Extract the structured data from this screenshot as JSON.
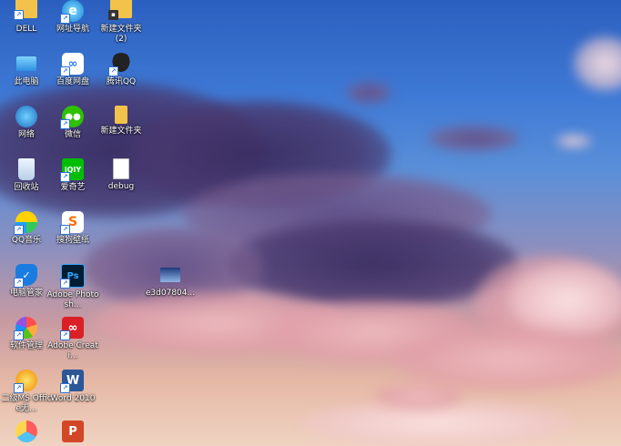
{
  "desktop": {
    "icons": [
      {
        "label": "DELL",
        "icon": "folder-icon"
      },
      {
        "label": "网址导航",
        "icon": "ie-browser-icon"
      },
      {
        "label": "新建文件夹\n(2)",
        "icon": "folder-icon"
      },
      {
        "label": "此电脑",
        "icon": "computer-icon"
      },
      {
        "label": "百度网盘",
        "icon": "baidu-netdisk-icon"
      },
      {
        "label": "腾讯QQ",
        "icon": "qq-penguin-icon"
      },
      {
        "label": "网络",
        "icon": "network-icon"
      },
      {
        "label": "微信",
        "icon": "wechat-icon"
      },
      {
        "label": "新建文件夹",
        "icon": "folder-icon"
      },
      {
        "label": "回收站",
        "icon": "recycle-bin-icon"
      },
      {
        "label": "爱奇艺",
        "icon": "iqiyi-icon"
      },
      {
        "label": "debug",
        "icon": "document-icon"
      },
      {
        "label": "QQ音乐",
        "icon": "qq-music-icon"
      },
      {
        "label": "搜狗壁纸",
        "icon": "sogou-wallpaper-icon"
      },
      {
        "label": "电脑管家",
        "icon": "pc-manager-icon"
      },
      {
        "label": "Adobe Photosh...",
        "icon": "photoshop-icon"
      },
      {
        "label": "e3d07804...",
        "icon": "image-file-icon"
      },
      {
        "label": "软件管理",
        "icon": "software-manager-icon"
      },
      {
        "label": "Adobe Creati...",
        "icon": "creative-cloud-icon"
      },
      {
        "label": "二级MS Office无...",
        "icon": "ms-office-exam-icon"
      },
      {
        "label": "Word 2010",
        "icon": "word-icon"
      },
      {
        "label": "",
        "icon": "app-icon"
      },
      {
        "label": "",
        "icon": "powerpoint-icon"
      }
    ]
  }
}
